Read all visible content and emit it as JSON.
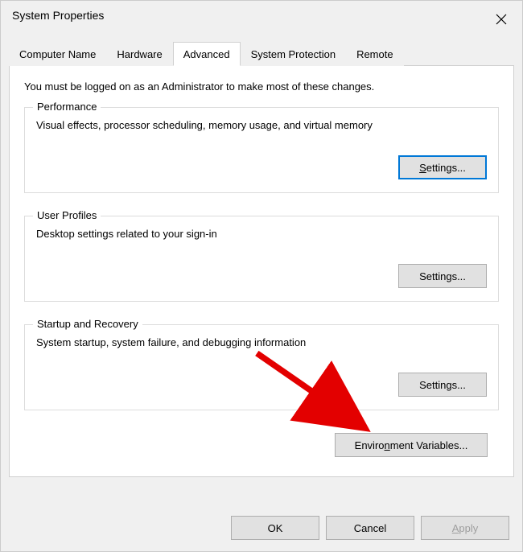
{
  "window": {
    "title": "System Properties"
  },
  "tabs": {
    "computer_name": "Computer Name",
    "hardware": "Hardware",
    "advanced": "Advanced",
    "system_protection": "System Protection",
    "remote": "Remote"
  },
  "intro": "You must be logged on as an Administrator to make most of these changes.",
  "performance": {
    "legend": "Performance",
    "desc": "Visual effects, processor scheduling, memory usage, and virtual memory",
    "button_prefix": "S",
    "button_rest": "ettings..."
  },
  "user_profiles": {
    "legend": "User Profiles",
    "desc": "Desktop settings related to your sign-in",
    "button_prefix": "S",
    "button_rest": "ettings..."
  },
  "startup_recovery": {
    "legend": "Startup and Recovery",
    "desc": "System startup, system failure, and debugging information",
    "button_prefix": "S",
    "button_rest": "ettings..."
  },
  "env_button": {
    "prefix": "Enviro",
    "ul": "n",
    "suffix": "ment Variables..."
  },
  "bottom": {
    "ok": "OK",
    "cancel": "Cancel",
    "apply_ul": "A",
    "apply_rest": "pply"
  }
}
